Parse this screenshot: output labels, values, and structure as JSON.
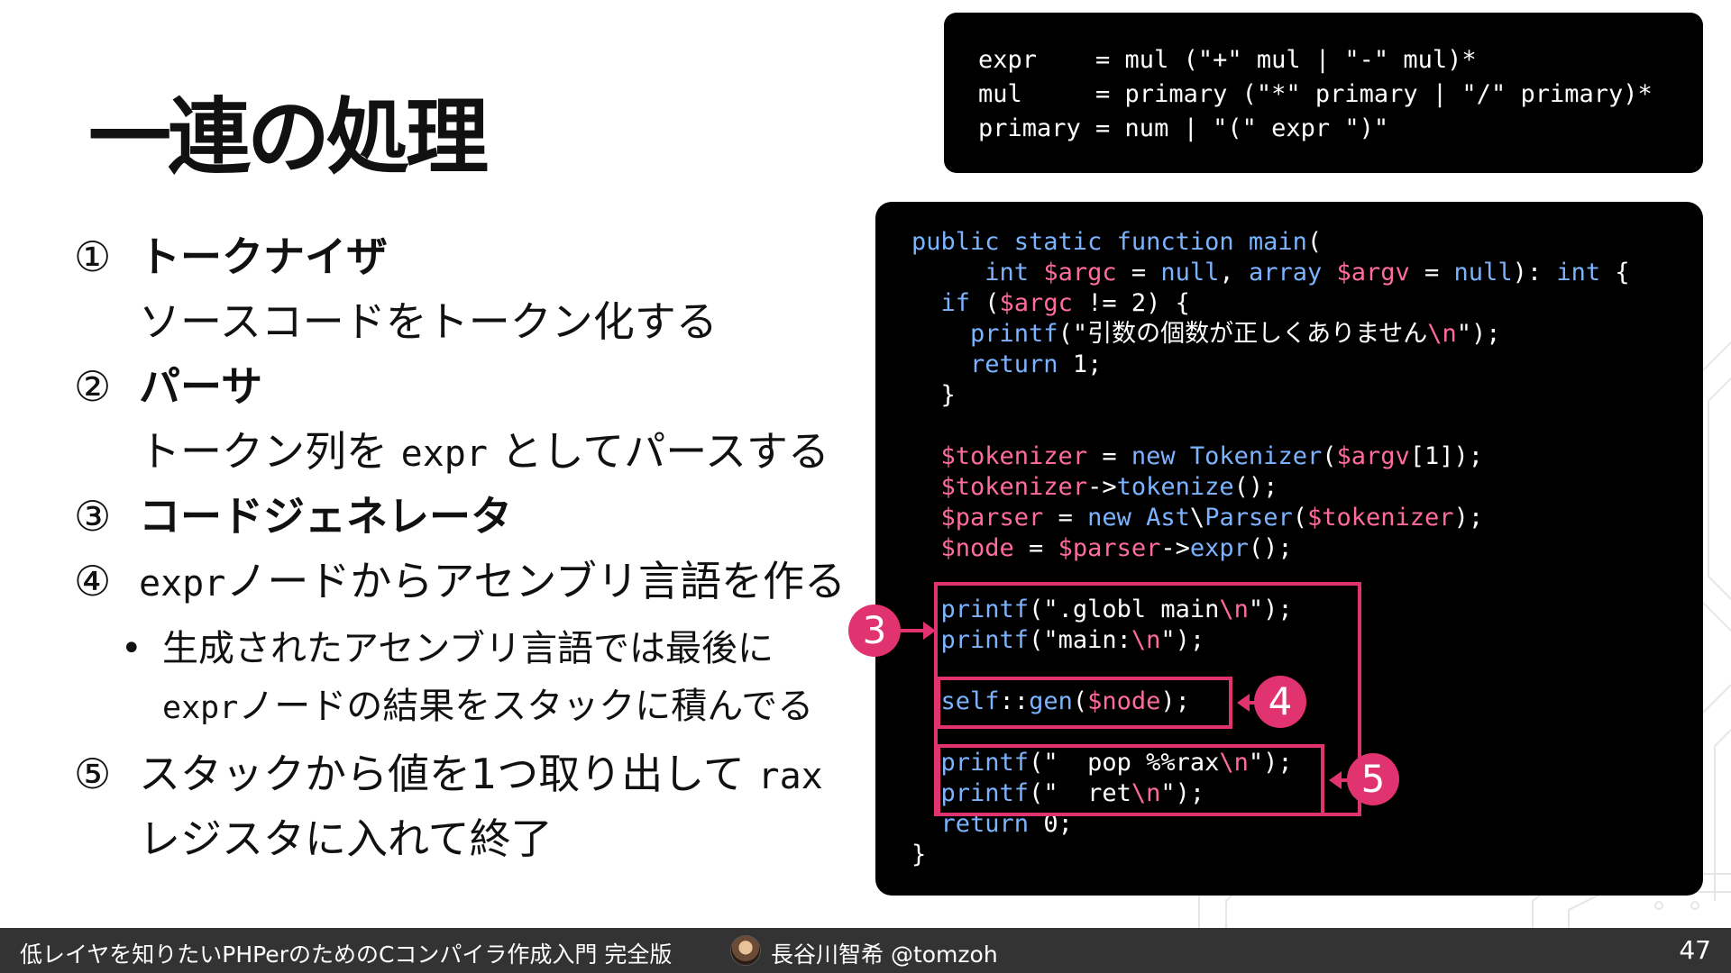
{
  "slide": {
    "title": "一連の処理"
  },
  "steps": {
    "s1": {
      "num": "①",
      "head": "トークナイザ",
      "sub": "ソースコードをトークン化する"
    },
    "s2": {
      "num": "②",
      "head": "パーサ",
      "sub_a": "トークン列を ",
      "sub_code": "expr",
      "sub_b": " としてパースする"
    },
    "s3": {
      "num": "③",
      "head": "コードジェネレータ"
    },
    "s4": {
      "num": "④",
      "code": "expr",
      "text": "ノードからアセンブリ言語を作る"
    },
    "bullet": {
      "dot": "•",
      "line1": "生成されたアセンブリ言語では最後に",
      "line2_code": "expr",
      "line2_text": "ノードの結果をスタックに積んでる"
    },
    "s5": {
      "num": "⑤",
      "text_a": "スタックから値を1つ取り出して ",
      "code": "rax",
      "line2": "レジスタに入れて終了"
    }
  },
  "grammar": [
    "expr    = mul (\"+\" mul | \"-\" mul)*",
    "mul     = primary (\"*\" primary | \"/\" primary)*",
    "primary = num | \"(\" expr \")\""
  ],
  "code": {
    "l1": {
      "kw": "public static function ",
      "name": "main",
      "rest": "("
    },
    "l2": {
      "a": "     ",
      "t1": "int",
      "sp1": " ",
      "v1": "$argc",
      "eq1": " = ",
      "n1": "null",
      "comma": ", ",
      "t2": "array",
      "sp2": " ",
      "v2": "$argv",
      "eq2": " = ",
      "n2": "null",
      "close": "): ",
      "t3": "int",
      "brace": " {"
    },
    "l3": {
      "a": "  ",
      "kw": "if",
      "b": " (",
      "v": "$argc",
      "c": " != 2) {"
    },
    "l4": {
      "a": "    ",
      "fn": "printf",
      "b": "(\"引数の個数が正しくありません",
      "esc": "\\n",
      "c": "\");"
    },
    "l5": {
      "a": "    ",
      "kw": "return",
      "b": " 1;"
    },
    "l6": "  }",
    "l7": "",
    "l8": {
      "a": "  ",
      "v1": "$tokenizer",
      "b": " = ",
      "kw": "new",
      "c": " ",
      "cls": "Tokenizer",
      "d": "(",
      "v2": "$argv",
      "e": "[1]);"
    },
    "l9": {
      "a": "  ",
      "v": "$tokenizer",
      "b": "->",
      "fn": "tokenize",
      "c": "();"
    },
    "l10": {
      "a": "  ",
      "v1": "$parser",
      "b": " = ",
      "kw": "new",
      "c": " ",
      "ns": "Ast",
      "d": "\\",
      "cls": "Parser",
      "e": "(",
      "v2": "$tokenizer",
      "f": ");"
    },
    "l11": {
      "a": "  ",
      "v1": "$node",
      "b": " = ",
      "v2": "$parser",
      "c": "->",
      "fn": "expr",
      "d": "();"
    },
    "l12": "",
    "l13": {
      "a": "  ",
      "fn": "printf",
      "b": "(\".globl main",
      "esc": "\\n",
      "c": "\");"
    },
    "l14": {
      "a": "  ",
      "fn": "printf",
      "b": "(\"main:",
      "esc": "\\n",
      "c": "\");"
    },
    "l15": "",
    "l16": {
      "a": "  ",
      "kw": "self",
      "b": "::",
      "fn": "gen",
      "c": "(",
      "v": "$node",
      "d": ");"
    },
    "l17": "",
    "l18": {
      "a": "  ",
      "fn": "printf",
      "b": "(\"  pop %%rax",
      "esc": "\\n",
      "c": "\");"
    },
    "l19": {
      "a": "  ",
      "fn": "printf",
      "b": "(\"  ret",
      "esc": "\\n",
      "c": "\");"
    },
    "l20": {
      "a": "  ",
      "kw": "return",
      "b": " 0;"
    },
    "l21": "}"
  },
  "markers": {
    "m3": "3",
    "m4": "4",
    "m5": "5"
  },
  "colors": {
    "accent": "#e0336f",
    "keyword": "#7cb3ff",
    "variable": "#ff6b9e",
    "footer_bg": "#333333"
  },
  "footer": {
    "title": "低レイヤを知りたいPHPerのためのCコンパイラ作成入門 完全版",
    "author": "長谷川智希 @tomzoh",
    "page": "47"
  }
}
